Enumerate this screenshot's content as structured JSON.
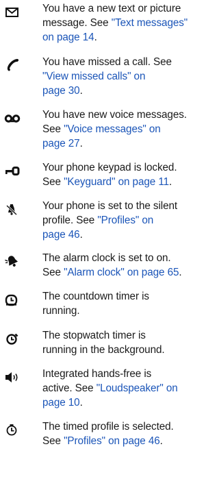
{
  "entries": [
    {
      "icon": "envelope-icon",
      "lines": [
        [
          {
            "t": "You have a new text or picture"
          }
        ],
        [
          {
            "t": "message. See "
          },
          {
            "t": "\"Text messages\"",
            "link": true
          }
        ],
        [
          {
            "t": "on page 14",
            "link": true
          },
          {
            "t": "."
          }
        ]
      ]
    },
    {
      "icon": "phone-handset-icon",
      "lines": [
        [
          {
            "t": "You have missed a call. See"
          }
        ],
        [
          {
            "t": "\"View missed calls\" on",
            "link": true
          }
        ],
        [
          {
            "t": "page 30",
            "link": true
          },
          {
            "t": "."
          }
        ]
      ]
    },
    {
      "icon": "voicemail-icon",
      "lines": [
        [
          {
            "t": "You have new voice messages."
          }
        ],
        [
          {
            "t": "See "
          },
          {
            "t": "\"Voice messages\" on",
            "link": true
          }
        ],
        [
          {
            "t": "page 27",
            "link": true
          },
          {
            "t": "."
          }
        ]
      ]
    },
    {
      "icon": "key-icon",
      "lines": [
        [
          {
            "t": "Your phone keypad is locked."
          }
        ],
        [
          {
            "t": "See "
          },
          {
            "t": "\"Keyguard\" on page 11",
            "link": true
          },
          {
            "t": "."
          }
        ]
      ]
    },
    {
      "icon": "silent-profile-icon",
      "lines": [
        [
          {
            "t": "Your phone is set to the silent"
          }
        ],
        [
          {
            "t": "profile. See "
          },
          {
            "t": "\"Profiles\" on",
            "link": true
          }
        ],
        [
          {
            "t": "page 46",
            "link": true
          },
          {
            "t": "."
          }
        ]
      ]
    },
    {
      "icon": "alarm-bell-icon",
      "lines": [
        [
          {
            "t": "The alarm clock is set to on."
          }
        ],
        [
          {
            "t": "See "
          },
          {
            "t": "\"Alarm clock\" on page 65",
            "link": true
          },
          {
            "t": "."
          }
        ]
      ]
    },
    {
      "icon": "countdown-timer-icon",
      "lines": [
        [
          {
            "t": "The countdown timer is"
          }
        ],
        [
          {
            "t": "running."
          }
        ]
      ]
    },
    {
      "icon": "stopwatch-icon",
      "lines": [
        [
          {
            "t": "The stopwatch timer is"
          }
        ],
        [
          {
            "t": "running in the background."
          }
        ]
      ]
    },
    {
      "icon": "loudspeaker-icon",
      "lines": [
        [
          {
            "t": "Integrated hands-free is"
          }
        ],
        [
          {
            "t": "active. See "
          },
          {
            "t": "\"Loudspeaker\" on",
            "link": true
          }
        ],
        [
          {
            "t": "page 10",
            "link": true
          },
          {
            "t": "."
          }
        ]
      ]
    },
    {
      "icon": "timed-profile-icon",
      "lines": [
        [
          {
            "t": "The timed profile is selected."
          }
        ],
        [
          {
            "t": "See "
          },
          {
            "t": "\"Profiles\" on page 46",
            "link": true
          },
          {
            "t": "."
          }
        ]
      ]
    }
  ]
}
